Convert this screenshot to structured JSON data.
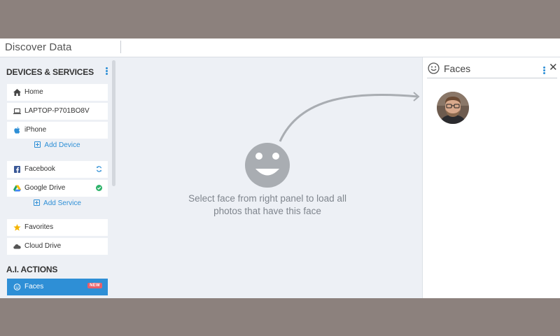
{
  "app": {
    "title": "Discover Data"
  },
  "sidebar": {
    "devices_heading": "DEVICES & SERVICES",
    "devices": [
      {
        "label": "Home",
        "icon": "home-icon"
      },
      {
        "label": "LAPTOP-P701BO8V",
        "icon": "laptop-icon"
      },
      {
        "label": "iPhone",
        "icon": "apple-icon"
      }
    ],
    "add_device_label": "Add Device",
    "services": [
      {
        "label": "Facebook",
        "icon": "facebook-icon",
        "status": "syncing"
      },
      {
        "label": "Google Drive",
        "icon": "google-drive-icon",
        "status": "connected"
      }
    ],
    "add_service_label": "Add Service",
    "extras": [
      {
        "label": "Favorites",
        "icon": "star-icon"
      },
      {
        "label": "Cloud Drive",
        "icon": "cloud-icon"
      }
    ],
    "ai_heading": "A.I. ACTIONS",
    "ai_items": [
      {
        "label": "Faces",
        "icon": "face-icon",
        "badge": "NEW",
        "active": true
      }
    ]
  },
  "main": {
    "hint": "Select face from right panel to load all photos that have this face"
  },
  "faces_panel": {
    "title": "Faces",
    "close_glyph": "✕"
  },
  "colors": {
    "accent": "#2e8fd6",
    "badge": "#e85f69",
    "background": "#edf0f5",
    "status_green": "#2fb36b"
  }
}
